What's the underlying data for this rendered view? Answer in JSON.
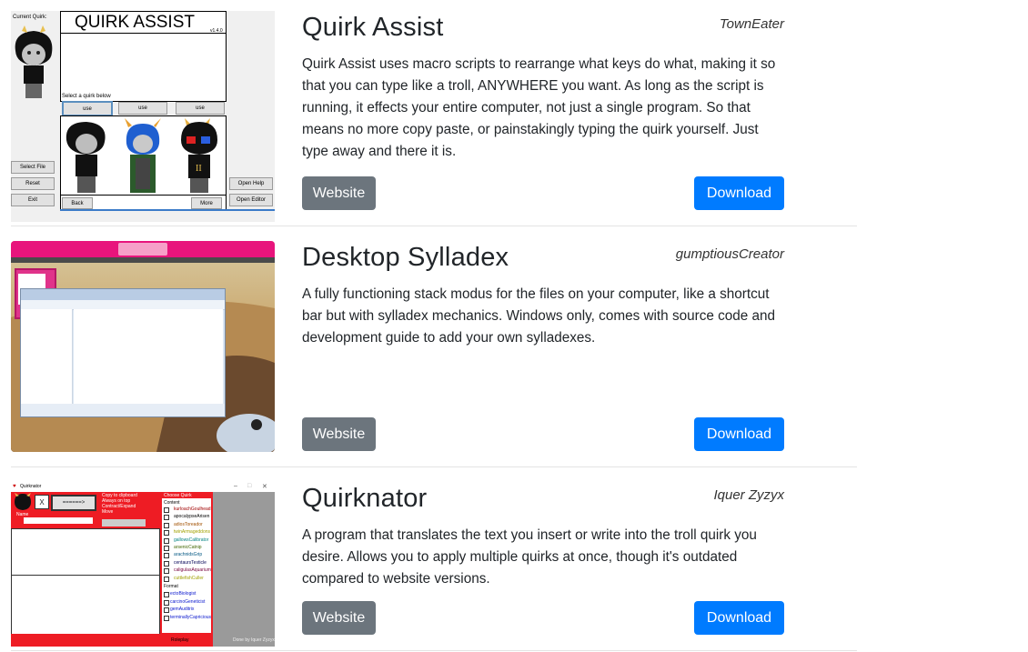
{
  "colors": {
    "website_button": "#6c757d",
    "download_button": "#007bff"
  },
  "items": [
    {
      "title": "Quirk Assist",
      "author": "TownEater",
      "description": "Quirk Assist uses macro scripts to rearrange what keys do what, making it so that you can type like a troll, ANYWHERE you want. As long as the script is running, it effects your entire computer, not just a single program. So that means no more copy paste, or painstakingly typing the quirk yourself. Just type away and there it is.",
      "website_label": "Website",
      "download_label": "Download",
      "thumbnail": {
        "current_quirk_label": "Current Quirk:",
        "app_title": "QUIRK ASSIST",
        "version": "v1.4.0",
        "select_label": "Select a quirk below",
        "use_label": "use",
        "select_file": "Select File",
        "reset": "Reset",
        "exit": "Exit",
        "back": "Back",
        "more": "More",
        "open_help": "Open Help",
        "open_editor": "Open Editor"
      }
    },
    {
      "title": "Desktop Sylladex",
      "author": "gumptiousCreator",
      "description": "A fully functioning stack modus for the files on your computer, like a shortcut bar but with sylladex mechanics. Windows only, comes with source code and development guide to add your own sylladexes.",
      "website_label": "Website",
      "download_label": "Download"
    },
    {
      "title": "Quirknator",
      "author": "Iquer Zyzyx",
      "description": "A program that translates the text you insert or write into the troll quirk you desire. Allows you to apply multiple quirks at once, though it's outdated compared to website versions.",
      "website_label": "Website",
      "download_label": "Download",
      "thumbnail": {
        "window_title": "Quirknator",
        "x_button": "X",
        "arrow_button": "======>",
        "options": [
          "Copy to clipboard",
          "Always on top",
          "Contract/Expand",
          "Move"
        ],
        "name_label": "Name",
        "quirk_panel_title": "Choose Quirk",
        "content_label": "Content",
        "quirks": [
          "kurloachGoulhead",
          "apocalypseArisen",
          "adiosToreador",
          "twinArmageddons",
          "gallowsCalibrator",
          "arsenicCatnip",
          "arachnidsGrip",
          "centaursTesticle",
          "caligulasAquarium",
          "cuttlefishCuller"
        ],
        "format_label": "Format",
        "formats": [
          "ectoBiologist",
          "carcinoGeneticist",
          "gemAuditrix",
          "terminallyCapricious"
        ],
        "roleplay": "Roleplay",
        "credit": "Done by Iquer Zyzyx"
      }
    }
  ]
}
